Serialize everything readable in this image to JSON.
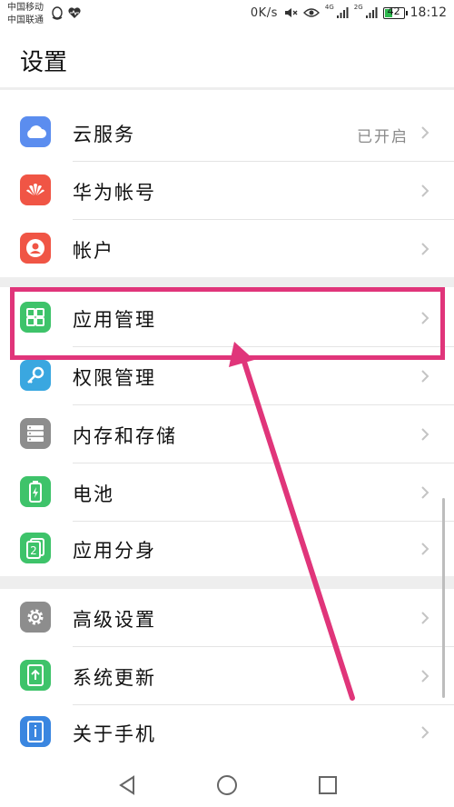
{
  "status": {
    "carrier1": "中国移动",
    "carrier2": "中国联通",
    "speed": "0K/s",
    "net1": "4G",
    "net2": "2G",
    "battery": "42",
    "battery_level": 0.42,
    "time": "18:12"
  },
  "page": {
    "title": "设置"
  },
  "items": [
    {
      "label": "云服务",
      "value": "已开启",
      "icon": "cloud-icon",
      "color": "#5b8def"
    },
    {
      "label": "华为帐号",
      "icon": "huawei-icon",
      "color": "#f05545"
    },
    {
      "label": "帐户",
      "icon": "account-icon",
      "color": "#f05545"
    },
    {
      "label": "应用管理",
      "icon": "apps-grid-icon",
      "color": "#3ec36a"
    },
    {
      "label": "权限管理",
      "icon": "key-icon",
      "color": "#3aa7e0"
    },
    {
      "label": "内存和存储",
      "icon": "storage-icon",
      "color": "#8d8d8d"
    },
    {
      "label": "电池",
      "icon": "battery-icon",
      "color": "#3ec36a"
    },
    {
      "label": "应用分身",
      "icon": "app-twin-icon",
      "color": "#3ec36a"
    },
    {
      "label": "高级设置",
      "icon": "gear-icon",
      "color": "#8d8d8d"
    },
    {
      "label": "系统更新",
      "icon": "system-update-icon",
      "color": "#3ec36a"
    },
    {
      "label": "关于手机",
      "icon": "info-icon",
      "color": "#3a86e0"
    }
  ],
  "annotation": {
    "color": "#e0357a"
  },
  "nav": {
    "back": "back-icon",
    "home": "home-icon",
    "recent": "recent-apps-icon"
  }
}
